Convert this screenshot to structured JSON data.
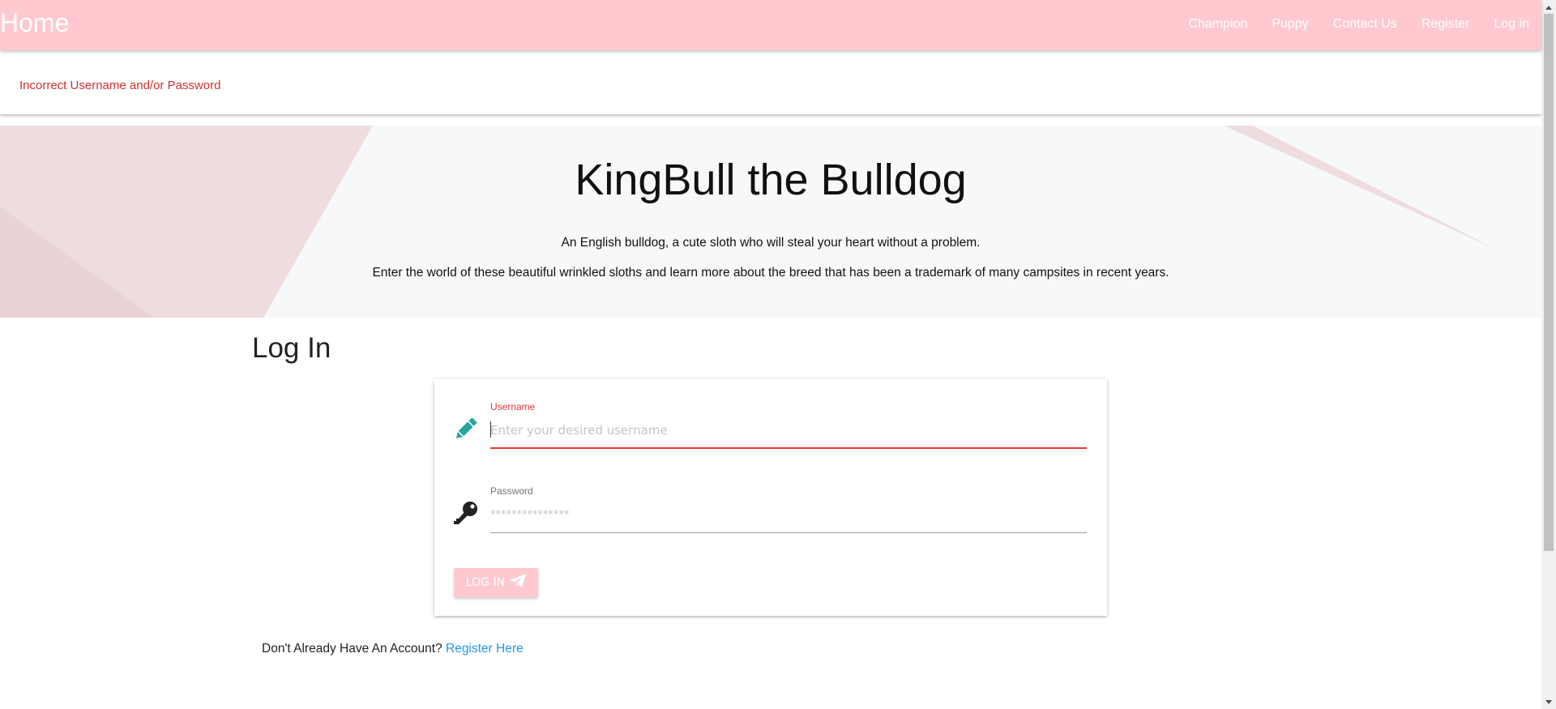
{
  "navbar": {
    "brand": "Home",
    "links": [
      "Champion",
      "Puppy",
      "Contact Us",
      "Register",
      "Log in"
    ]
  },
  "alert": {
    "message": "Incorrect Username and/or Password"
  },
  "hero": {
    "title": "KingBull the Bulldog",
    "line1": "An English bulldog, a cute sloth who will steal your heart without a problem.",
    "line2": "Enter the world of these beautiful wrinkled sloths and learn more about the breed that has been a trademark of many campsites in recent years."
  },
  "login": {
    "title": "Log In",
    "username": {
      "label": "Username",
      "placeholder": "Enter your desired username",
      "icon": "pencil-icon"
    },
    "password": {
      "label": "Password",
      "placeholder": "***************",
      "icon": "key-icon"
    },
    "submit_label": "Log in",
    "submit_icon": "paper-plane-icon"
  },
  "register": {
    "prompt": "Don't Already Have An Account?",
    "link": "Register Here"
  },
  "colors": {
    "navbar": "#ffc9cf",
    "error": "#d32f2f",
    "icon_teal": "#26a69a",
    "link": "#2196f3"
  }
}
